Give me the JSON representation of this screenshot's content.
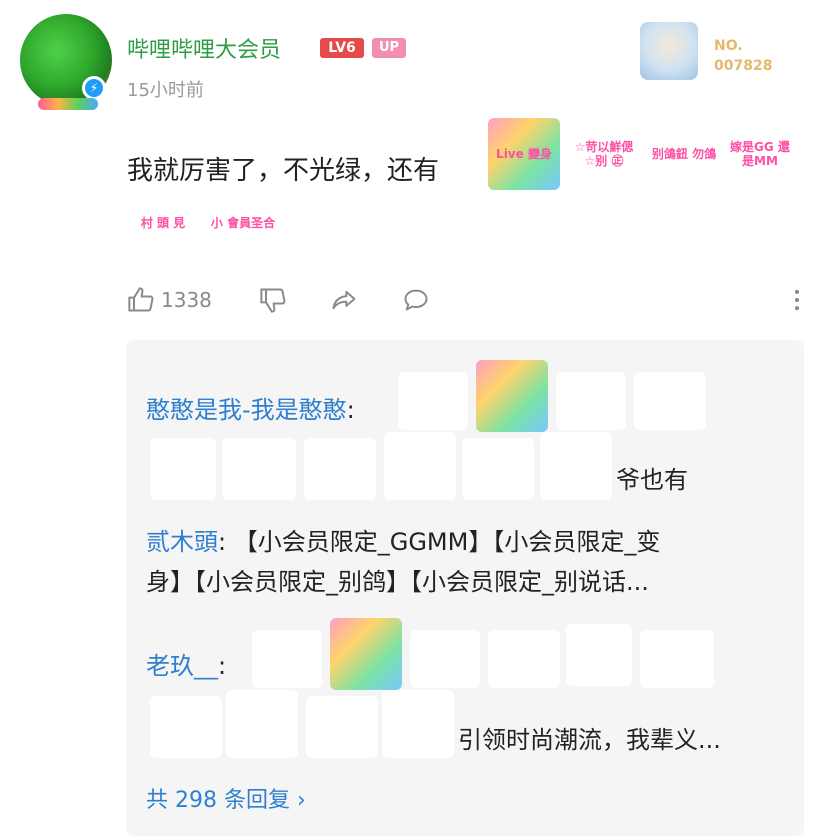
{
  "post": {
    "username": "哔哩哔哩大会员",
    "level_badge": "LV6",
    "up_badge": "UP",
    "time": "15小时前",
    "fan_number_label": "NO.",
    "fan_number": "007828",
    "comment_text": "我就厉害了，不光绿，还有",
    "likes": "1338"
  },
  "stickers_row1": [
    "Live 變身",
    "☆苛以鮮偲 ☆别 ㊣",
    "别鴿鈕 勿鴿",
    "嫁是GG 還是MM"
  ],
  "stickers_row2": [
    "村 頭 見",
    "小 會員圣合"
  ],
  "replies": [
    {
      "name": "憨憨是我-我是憨憨",
      "sep": ":",
      "text_end": "爷也有"
    },
    {
      "name": "贰木頭",
      "sep": ":",
      "text_line1": "【小会员限定_GGMM】【小会员限定_变",
      "text_line2": "身】【小会员限定_别鸽】【小会员限定_别说话..."
    },
    {
      "name": "老玖__",
      "sep": ":",
      "text_end": "引领时尚潮流，我辈义..."
    }
  ],
  "total_replies": "共 298 条回复 ›"
}
